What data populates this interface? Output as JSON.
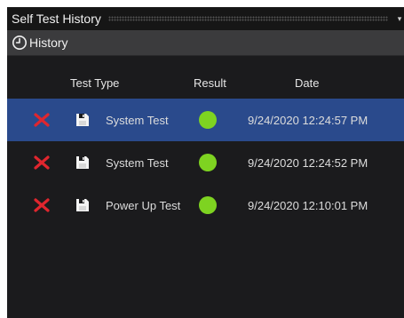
{
  "window": {
    "title": "Self Test History",
    "menu_glyph": "▾"
  },
  "section": {
    "icon": "clock-icon",
    "label": "History"
  },
  "table": {
    "columns": [
      "Test Type",
      "Result",
      "Date"
    ],
    "rows": [
      {
        "selected": true,
        "delete_icon": "red-x-icon",
        "type_icon": "save-disk-icon",
        "test_type": "System Test",
        "result": "pass",
        "result_color": "#7ed321",
        "date": "9/24/2020 12:24:57 PM"
      },
      {
        "selected": false,
        "delete_icon": "red-x-icon",
        "type_icon": "save-disk-icon",
        "test_type": "System Test",
        "result": "pass",
        "result_color": "#7ed321",
        "date": "9/24/2020 12:24:52 PM"
      },
      {
        "selected": false,
        "delete_icon": "red-x-icon",
        "type_icon": "save-disk-icon",
        "test_type": "Power Up Test",
        "result": "pass",
        "result_color": "#7ed321",
        "date": "9/24/2020 12:10:01 PM"
      }
    ]
  },
  "colors": {
    "selection": "#2a4a8c",
    "delete_x": "#e0262e",
    "pass": "#7ed321"
  }
}
